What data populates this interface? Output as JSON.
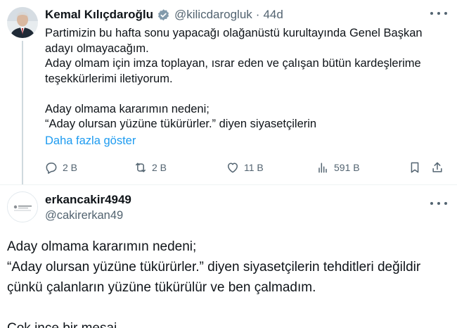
{
  "original_tweet": {
    "author_name": "Kemal Kılıçdaroğlu",
    "handle": "@kilicdarogluk",
    "separator": "·",
    "time": "44d",
    "body_lines": [
      "Partimizin bu hafta sonu yapacağı olağanüstü kurultayında Genel Başkan",
      "adayı olmayacağım.",
      "Aday olmam için imza toplayan, ısrar eden ve çalışan bütün kardeşlerime",
      "teşekkürlerimi iletiyorum.",
      "",
      "Aday olmama kararımın nedeni;",
      "“Aday olursan yüzüne tükürürler.” diyen siyasetçilerin"
    ],
    "show_more": "Daha fazla göster",
    "actions": {
      "replies": "2 B",
      "retweets": "2 B",
      "likes": "11 B",
      "views": "591 B"
    },
    "badge_color": "#829aab"
  },
  "reply_tweet": {
    "author_name": "erkancakir4949",
    "handle": "@cakirerkan49",
    "body_lines": [
      "Aday olmama kararımın nedeni;",
      "“Aday olursan yüzüne tükürürler.” diyen siyasetçilerin tehditleri değildir",
      "çünkü çalanların yüzüne tükürülür ve ben çalmadım.",
      "",
      "Çok ince bir mesaj..."
    ]
  },
  "colors": {
    "text": "#0f1419",
    "secondary": "#536471",
    "link": "#1d9bf0"
  }
}
